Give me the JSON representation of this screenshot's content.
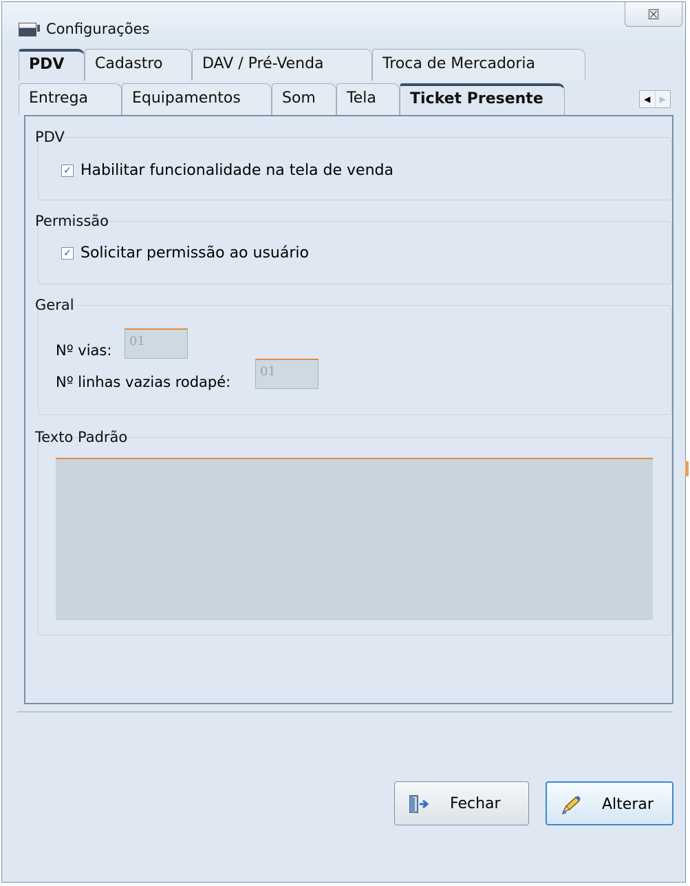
{
  "window": {
    "title": "Configurações",
    "close_glyph": "☒"
  },
  "tabs_row1": [
    {
      "label": "PDV",
      "active": true
    },
    {
      "label": "Cadastro",
      "active": false
    },
    {
      "label": "DAV / Pré-Venda",
      "active": false
    },
    {
      "label": "Troca de Mercadoria",
      "active": false
    }
  ],
  "tabs_row2": [
    {
      "label": "Entrega",
      "active": false
    },
    {
      "label": "Equipamentos",
      "active": false
    },
    {
      "label": "Som",
      "active": false
    },
    {
      "label": "Tela",
      "active": false
    },
    {
      "label": "Ticket Presente",
      "active": true
    }
  ],
  "tab_scroll": {
    "left": "◀",
    "right": "▶"
  },
  "groups": {
    "pdv": {
      "title": "PDV",
      "checkbox_label": "Habilitar funcionalidade na tela de venda",
      "checked": true
    },
    "permissao": {
      "title": "Permissão",
      "checkbox_label": "Solicitar permissão ao usuário",
      "checked": true
    },
    "geral": {
      "title": "Geral",
      "vias_label": "Nº vias:",
      "vias_value": "01",
      "linhas_label": "Nº linhas vazias rodapé:",
      "linhas_value": "01"
    },
    "texto_padrao": {
      "title": "Texto Padrão",
      "value": ""
    }
  },
  "checkmark": "✓",
  "buttons": {
    "fechar": "Fechar",
    "alterar": "Alterar"
  },
  "colors": {
    "accent_orange": "#e38a3a",
    "window_bg": "#dfe8f2",
    "primary_button_border": "#3f87c9"
  }
}
